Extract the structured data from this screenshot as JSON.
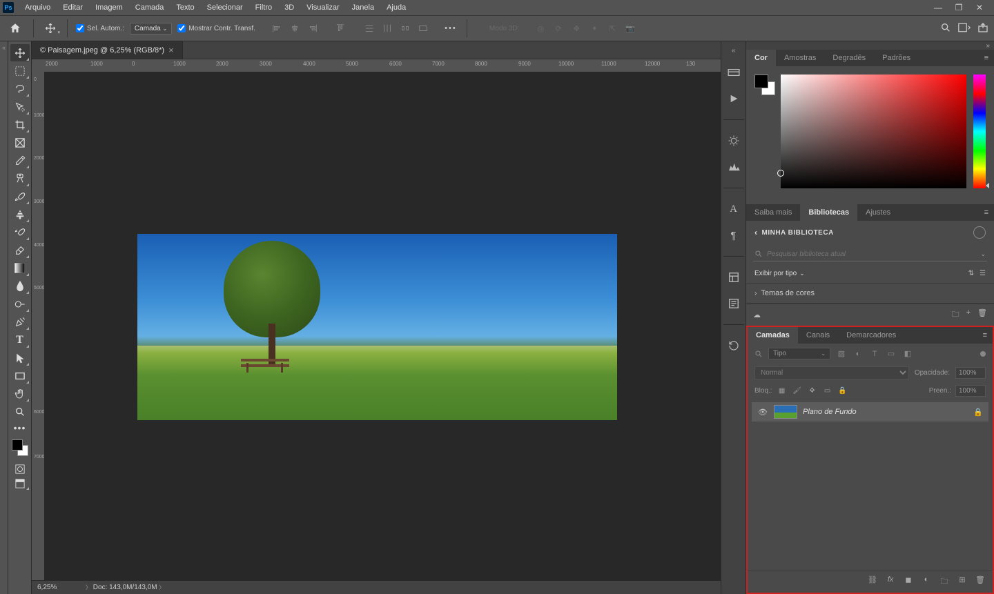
{
  "app_logo": "Ps",
  "menu": [
    "Arquivo",
    "Editar",
    "Imagem",
    "Camada",
    "Texto",
    "Selecionar",
    "Filtro",
    "3D",
    "Visualizar",
    "Janela",
    "Ajuda"
  ],
  "options": {
    "auto_select_label": "Sel. Autom.:",
    "target_dropdown": "Camada",
    "show_transform_label": "Mostrar Contr. Transf.",
    "mode3d_label": "Modo 3D:"
  },
  "document": {
    "tab_title": "© Paisagem.jpeg @ 6,25% (RGB/8*)"
  },
  "ruler_h": [
    "2000",
    "1000",
    "0",
    "1000",
    "2000",
    "3000",
    "4000",
    "5000",
    "6000",
    "7000",
    "8000",
    "9000",
    "10000",
    "11000",
    "12000",
    "130"
  ],
  "ruler_v": [
    "0",
    "1000",
    "2000",
    "3000",
    "4000",
    "5000",
    "6000",
    "7000"
  ],
  "status": {
    "zoom": "6,25%",
    "doc_info": "Doc: 143,0M/143,0M"
  },
  "color_panel": {
    "tabs": [
      "Cor",
      "Amostras",
      "Degradês",
      "Padrões"
    ],
    "active_tab": 0
  },
  "learn_panel": {
    "tabs": [
      "Saiba mais",
      "Bibliotecas",
      "Ajustes"
    ],
    "active_tab": 1,
    "header": "MINHA BIBLIOTECA",
    "search_placeholder": "Pesquisar biblioteca atual",
    "filter_label": "Exibir por tipo",
    "section": "Temas de cores"
  },
  "layers_panel": {
    "tabs": [
      "Camadas",
      "Canais",
      "Demarcadores"
    ],
    "active_tab": 0,
    "filter_type": "Tipo",
    "blend_mode": "Normal",
    "opacity_label": "Opacidade:",
    "opacity_value": "100%",
    "lock_label": "Bloq.:",
    "fill_label": "Preen.:",
    "fill_value": "100%",
    "layer_name": "Plano de Fundo"
  }
}
